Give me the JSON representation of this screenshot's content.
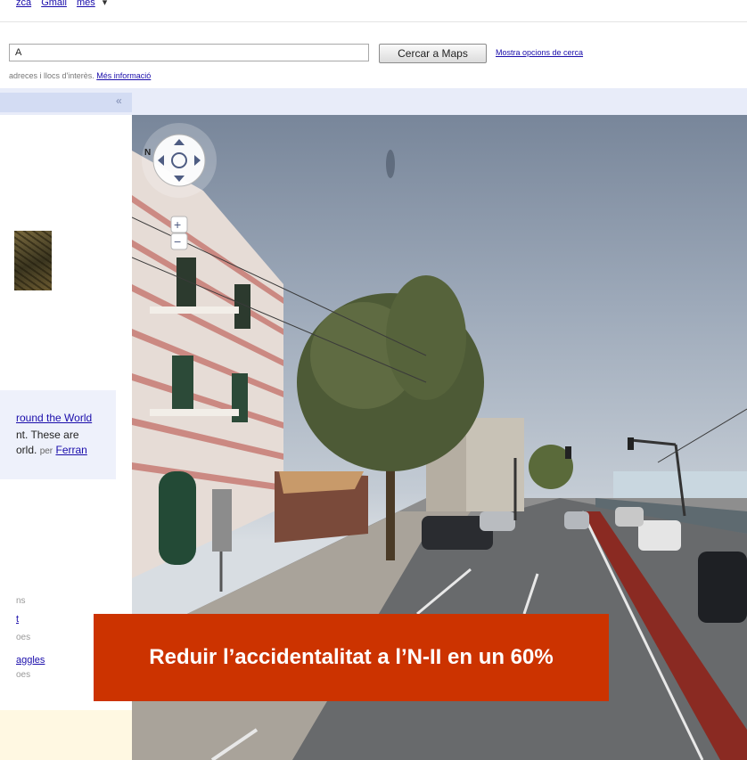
{
  "top_links": [
    "zca",
    "Gmail",
    "més"
  ],
  "search": {
    "value": "A",
    "button_label": "Cercar a Maps",
    "options_link": "Mostra opcions de cerca",
    "hint_prefix": "adreces i llocs d'interès.",
    "hint_link": "Més informació"
  },
  "panel": {
    "collapse_label": "«",
    "featured": {
      "title_link": "round the World",
      "text_line1": "nt. These are",
      "text_line2": "orld.",
      "by_label": "per",
      "author_link": "Ferran"
    },
    "items": [
      {
        "label": "ns"
      },
      {
        "label": "t"
      },
      {
        "label": "oes"
      },
      {
        "label": "aggles"
      },
      {
        "label": "oes"
      }
    ]
  },
  "street_view": {
    "compass_label": "N",
    "zoom_in_label": "+",
    "zoom_out_label": "−"
  },
  "caption": "Reduir l’accidentalitat a l’N-II en un 60%",
  "colors": {
    "caption_bg": "#cc3300",
    "link": "#1a0dab",
    "map_bar": "#e8ecf9"
  }
}
